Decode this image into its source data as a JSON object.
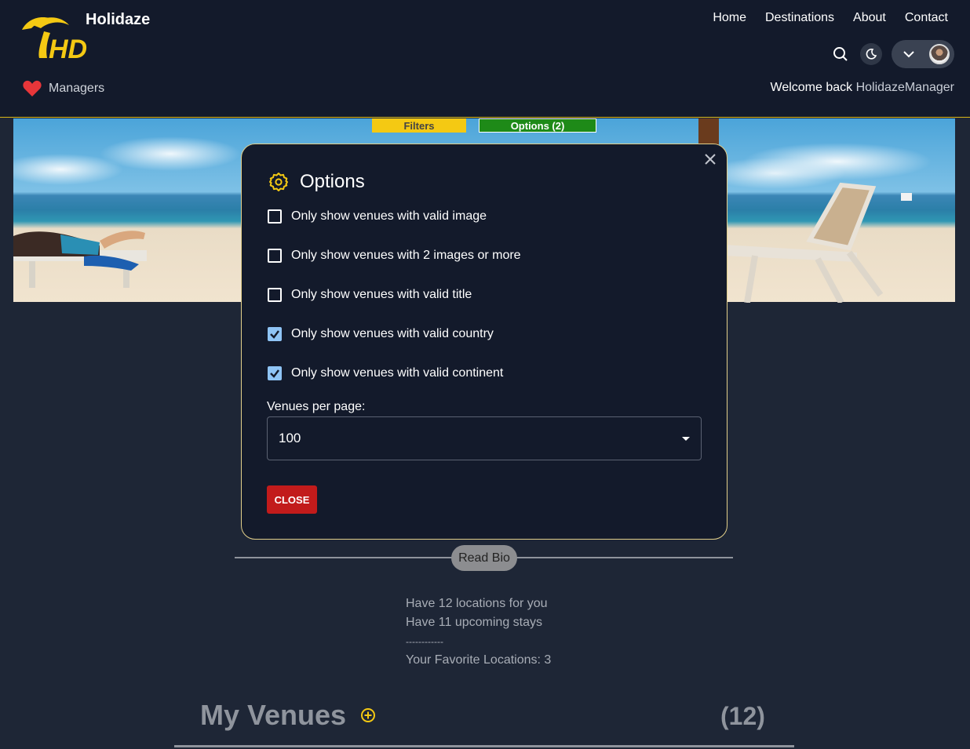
{
  "header": {
    "brand": "Holidaze",
    "nav": [
      "Home",
      "Destinations",
      "About",
      "Contact"
    ],
    "managers_label": "Managers",
    "welcome_prefix": "Welcome back",
    "username": "HolidazeManager"
  },
  "tabs": {
    "filters": "Filters",
    "options": "Options (2)"
  },
  "modal": {
    "title": "Options",
    "options": [
      {
        "label": "Only show venues with valid image",
        "checked": false
      },
      {
        "label": "Only show venues with 2 images or more",
        "checked": false
      },
      {
        "label": "Only show venues with valid title",
        "checked": false
      },
      {
        "label": "Only show venues with valid country",
        "checked": true
      },
      {
        "label": "Only show venues with valid continent",
        "checked": true
      }
    ],
    "venues_per_page_label": "Venues per page:",
    "venues_per_page_value": "100",
    "close_label": "CLOSE"
  },
  "profile": {
    "read_bio": "Read Bio",
    "locations_line": "Have 12 locations for you",
    "upcoming_line": "Have 11 upcoming stays",
    "separator": "------------",
    "favorites_line": "Your Favorite Locations: 3"
  },
  "venues": {
    "title": "My Venues",
    "count": "(12)"
  },
  "colors": {
    "accent_yellow": "#f4c913",
    "options_green": "#1e8a18",
    "close_red": "#c21b1b",
    "checkbox_blue": "#8fc4f5"
  },
  "icons": [
    "search-icon",
    "moon-icon",
    "chevron-down-icon",
    "heart-icon",
    "gear-icon",
    "close-icon",
    "add-circle-icon"
  ]
}
